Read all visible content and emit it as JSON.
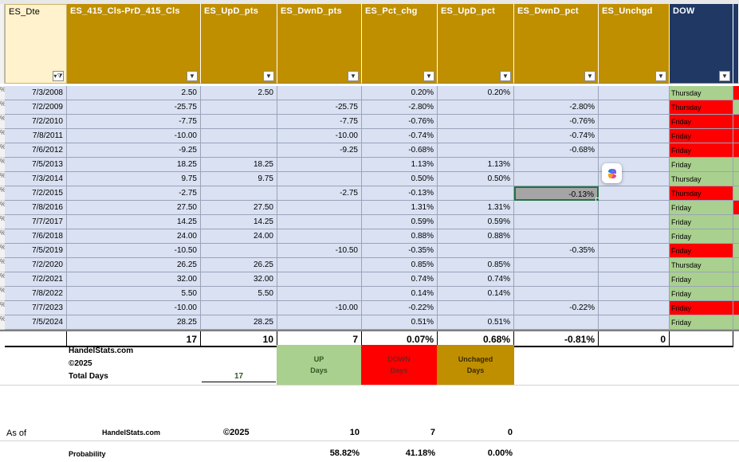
{
  "colors": {
    "row_bg": "#d9e1f2",
    "header_gold": "#bf8f00",
    "header_navy": "#1f3864",
    "header_light": "#fff2cc",
    "dow_green": "#a9d08e",
    "dow_red": "#ff0000",
    "up_green": "#a9d08e",
    "down_red": "#ff0000",
    "unch_gold": "#bf8f00",
    "days_green_text": "#375623"
  },
  "headers": {
    "date": "ES_Dte",
    "cls": "ES_415_Cls-PrD_415_Cls",
    "up_pts": "ES_UpD_pts",
    "dwn_pts": "ES_DwnD_pts",
    "pct_chg": "ES_Pct_chg",
    "up_pct": "ES_UpD_pct",
    "dwn_pct": "ES_DwnD_pct",
    "unchgd": "ES_Unchgd",
    "dow": "DOW"
  },
  "filter_icons": {
    "date": "filter-applied-icon",
    "other": "dropdown-arrow-icon"
  },
  "rows": [
    {
      "date": "7/3/2008",
      "cls": "2.50",
      "up": "2.50",
      "dwn": "",
      "pct": "0.20%",
      "up_pct": "0.20%",
      "dwn_pct": "",
      "unch": "",
      "dow": "Thursday",
      "dow_color": "green",
      "right_edge": "red"
    },
    {
      "date": "7/2/2009",
      "cls": "-25.75",
      "up": "",
      "dwn": "-25.75",
      "pct": "-2.80%",
      "up_pct": "",
      "dwn_pct": "-2.80%",
      "unch": "",
      "dow": "Thursday",
      "dow_color": "red",
      "right_edge": "green"
    },
    {
      "date": "7/2/2010",
      "cls": "-7.75",
      "up": "",
      "dwn": "-7.75",
      "pct": "-0.76%",
      "up_pct": "",
      "dwn_pct": "-0.76%",
      "unch": "",
      "dow": "Friday",
      "dow_color": "red",
      "right_edge": "red"
    },
    {
      "date": "7/8/2011",
      "cls": "-10.00",
      "up": "",
      "dwn": "-10.00",
      "pct": "-0.74%",
      "up_pct": "",
      "dwn_pct": "-0.74%",
      "unch": "",
      "dow": "Friday",
      "dow_color": "red",
      "right_edge": "red"
    },
    {
      "date": "7/6/2012",
      "cls": "-9.25",
      "up": "",
      "dwn": "-9.25",
      "pct": "-0.68%",
      "up_pct": "",
      "dwn_pct": "-0.68%",
      "unch": "",
      "dow": "Friday",
      "dow_color": "red",
      "right_edge": "red"
    },
    {
      "date": "7/5/2013",
      "cls": "18.25",
      "up": "18.25",
      "dwn": "",
      "pct": "1.13%",
      "up_pct": "1.13%",
      "dwn_pct": "",
      "unch": "",
      "dow": "Friday",
      "dow_color": "green",
      "right_edge": "green"
    },
    {
      "date": "7/3/2014",
      "cls": "9.75",
      "up": "9.75",
      "dwn": "",
      "pct": "0.50%",
      "up_pct": "0.50%",
      "dwn_pct": "",
      "unch": "",
      "dow": "Thursday",
      "dow_color": "green",
      "right_edge": "green"
    },
    {
      "date": "7/2/2015",
      "cls": "-2.75",
      "up": "",
      "dwn": "-2.75",
      "pct": "-0.13%",
      "up_pct": "",
      "dwn_pct": "-0.13%",
      "unch": "",
      "dow": "Thursday",
      "dow_color": "red",
      "right_edge": "green"
    },
    {
      "date": "7/8/2016",
      "cls": "27.50",
      "up": "27.50",
      "dwn": "",
      "pct": "1.31%",
      "up_pct": "1.31%",
      "dwn_pct": "",
      "unch": "",
      "dow": "Friday",
      "dow_color": "green",
      "right_edge": "red"
    },
    {
      "date": "7/7/2017",
      "cls": "14.25",
      "up": "14.25",
      "dwn": "",
      "pct": "0.59%",
      "up_pct": "0.59%",
      "dwn_pct": "",
      "unch": "",
      "dow": "Friday",
      "dow_color": "green",
      "right_edge": "green"
    },
    {
      "date": "7/6/2018",
      "cls": "24.00",
      "up": "24.00",
      "dwn": "",
      "pct": "0.88%",
      "up_pct": "0.88%",
      "dwn_pct": "",
      "unch": "",
      "dow": "Friday",
      "dow_color": "green",
      "right_edge": "green"
    },
    {
      "date": "7/5/2019",
      "cls": "-10.50",
      "up": "",
      "dwn": "-10.50",
      "pct": "-0.35%",
      "up_pct": "",
      "dwn_pct": "-0.35%",
      "unch": "",
      "dow": "Friday",
      "dow_color": "red",
      "right_edge": "green"
    },
    {
      "date": "7/2/2020",
      "cls": "26.25",
      "up": "26.25",
      "dwn": "",
      "pct": "0.85%",
      "up_pct": "0.85%",
      "dwn_pct": "",
      "unch": "",
      "dow": "Thursday",
      "dow_color": "green",
      "right_edge": "green"
    },
    {
      "date": "7/2/2021",
      "cls": "32.00",
      "up": "32.00",
      "dwn": "",
      "pct": "0.74%",
      "up_pct": "0.74%",
      "dwn_pct": "",
      "unch": "",
      "dow": "Friday",
      "dow_color": "green",
      "right_edge": "green"
    },
    {
      "date": "7/8/2022",
      "cls": "5.50",
      "up": "5.50",
      "dwn": "",
      "pct": "0.14%",
      "up_pct": "0.14%",
      "dwn_pct": "",
      "unch": "",
      "dow": "Friday",
      "dow_color": "green",
      "right_edge": "green"
    },
    {
      "date": "7/7/2023",
      "cls": "-10.00",
      "up": "",
      "dwn": "-10.00",
      "pct": "-0.22%",
      "up_pct": "",
      "dwn_pct": "-0.22%",
      "unch": "",
      "dow": "Friday",
      "dow_color": "red",
      "right_edge": "red"
    },
    {
      "date": "7/5/2024",
      "cls": "28.25",
      "up": "28.25",
      "dwn": "",
      "pct": "0.51%",
      "up_pct": "0.51%",
      "dwn_pct": "",
      "unch": "",
      "dow": "Friday",
      "dow_color": "green",
      "right_edge": "green"
    }
  ],
  "selected_row_index": 7,
  "totals": {
    "cls": "17",
    "up": "10",
    "dwn": "7",
    "pct": "0.07%",
    "up_pct": "0.68%",
    "dwn_pct": "-0.81%",
    "unch": "0"
  },
  "summary": {
    "site": "HandelStats.com",
    "copyright": "©2025",
    "total_days_label": "Total Days",
    "total_days_value": "17",
    "up_line1": "UP",
    "up_line2": "Days",
    "down_line1": "DOWN",
    "down_line2": "Days",
    "unch_line1": "Unchaged",
    "unch_line2": "Days",
    "as_of_label": "As of",
    "site2": "HandelStats.com",
    "copyright2": "©2025",
    "up_count": "10",
    "down_count": "7",
    "unch_count": "0",
    "prob_label": "Probability",
    "up_prob": "58.82%",
    "down_prob": "41.18%",
    "unch_prob": "0.00%"
  }
}
